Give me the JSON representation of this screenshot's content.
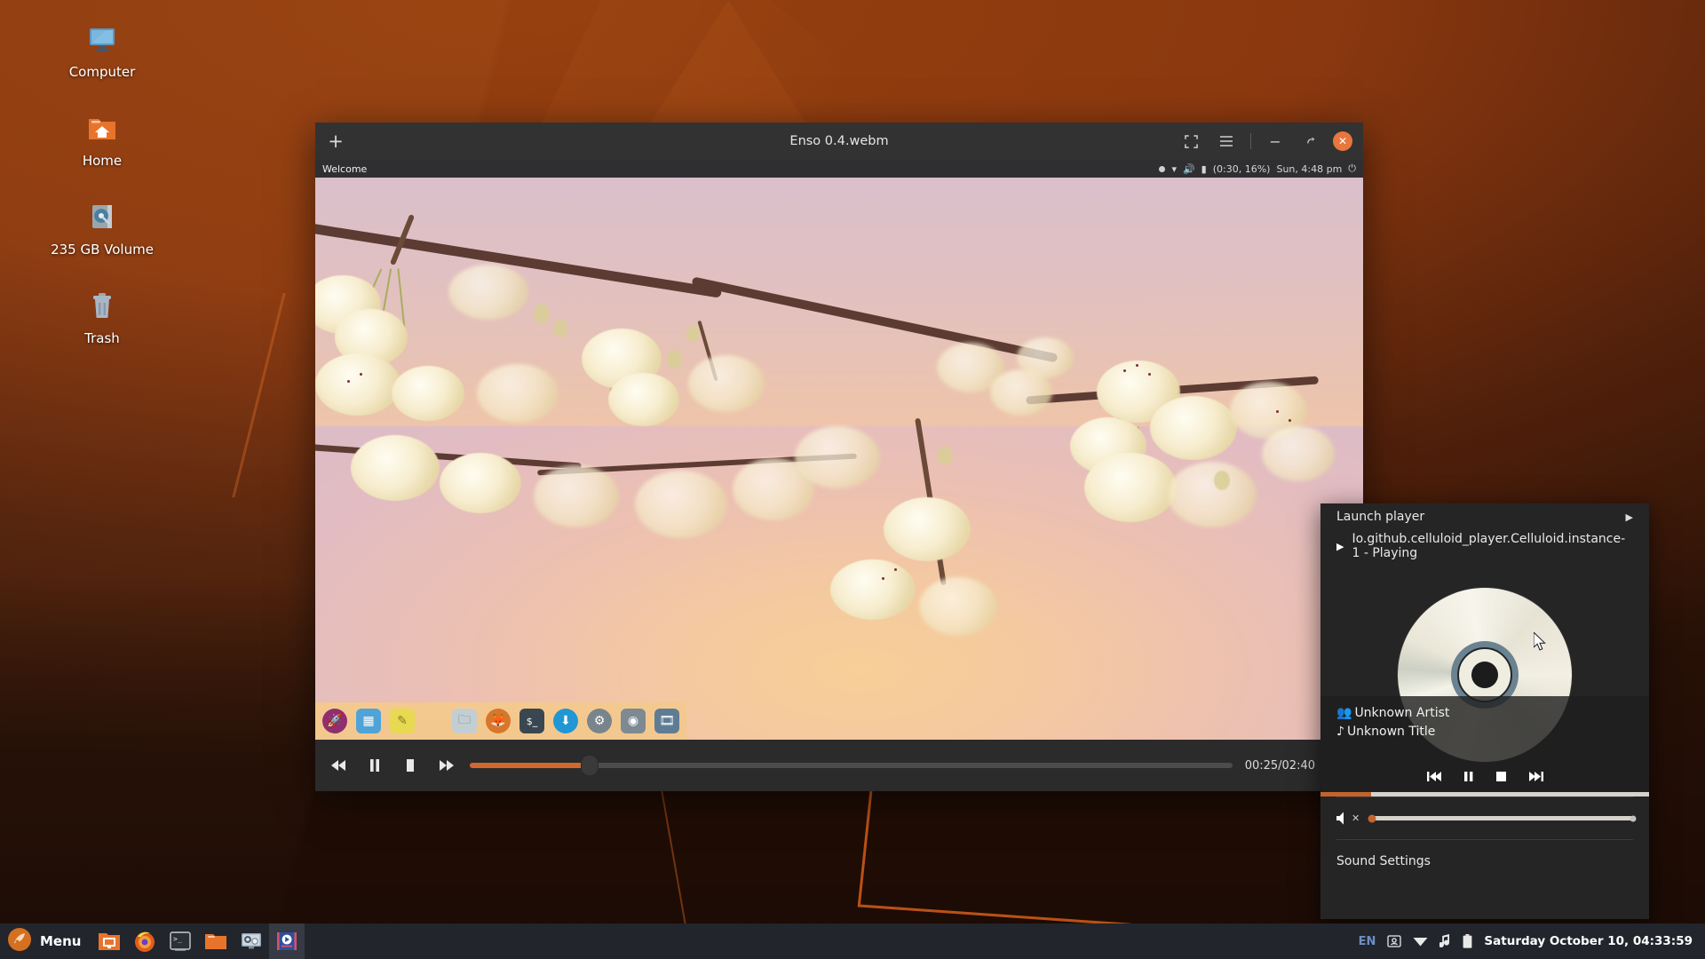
{
  "desktop": {
    "icons": [
      {
        "label": "Computer",
        "icon": "computer-monitor-icon"
      },
      {
        "label": "Home",
        "icon": "home-folder-icon"
      },
      {
        "label": "235 GB Volume",
        "icon": "hard-drive-icon"
      },
      {
        "label": "Trash",
        "icon": "trash-icon"
      }
    ],
    "wallpaper_color": "#8c3a10"
  },
  "player_window": {
    "title": "Enso 0.4.webm",
    "new_tab_label": "+",
    "buttons": {
      "fullscreen": "fullscreen-icon",
      "menu": "hamburger-menu-icon",
      "minimize": "−",
      "restore": "restore-icon",
      "close": "✕"
    },
    "controls": {
      "rewind": "rewind-icon",
      "pause": "pause-icon",
      "stop": "stop-icon",
      "forward": "fast-forward-icon",
      "time": "00:25/02:40",
      "progress_percent": 15.6,
      "track_icon": "add-track-icon"
    },
    "inner_capture": {
      "workspace_label": "Welcome",
      "status": "(0:30, 16%)",
      "clock": "Sun, 4:48 pm",
      "dock_icons": [
        "rocket-launcher-icon",
        "workspace-switcher-icon",
        "notes-icon",
        "files-icon",
        "firefox-icon",
        "terminal-icon",
        "download-icon",
        "settings-gear-icon",
        "drive-sync-icon",
        "media-player-icon"
      ]
    }
  },
  "sound_panel": {
    "launch_player_label": "Launch player",
    "launch_player_arrow": "chevron-right-icon",
    "player_entry": "Io.github.celluloid_player.Celluloid.instance-1 - Playing",
    "player_entry_icon": "play-triangle-icon",
    "artist": "Unknown Artist",
    "artist_icon": "artist-people-icon",
    "title": "Unknown Title",
    "title_icon": "music-note-icon",
    "transport": {
      "previous": "skip-previous-icon",
      "pause": "pause-icon",
      "stop": "stop-icon",
      "next": "skip-next-icon"
    },
    "media_progress_percent": 15.5,
    "volume_icon": "volume-muted-icon",
    "volume_percent": 0,
    "sound_settings_label": "Sound Settings",
    "album_art_icon": "compact-disc-icon",
    "accent_color": "#c2642c"
  },
  "taskbar": {
    "menu_label": "Menu",
    "menu_icon": "mint-menu-icon",
    "launchers": [
      "show-desktop-icon",
      "firefox-icon",
      "terminal-icon",
      "file-manager-icon",
      "screen-recorder-icon",
      "celluloid-player-icon"
    ],
    "tray": {
      "keyboard_layout": "EN",
      "icons": [
        "user-account-icon",
        "network-wifi-icon",
        "media-note-icon",
        "battery-icon"
      ],
      "clock": "Saturday October 10, 04:33:59"
    }
  }
}
